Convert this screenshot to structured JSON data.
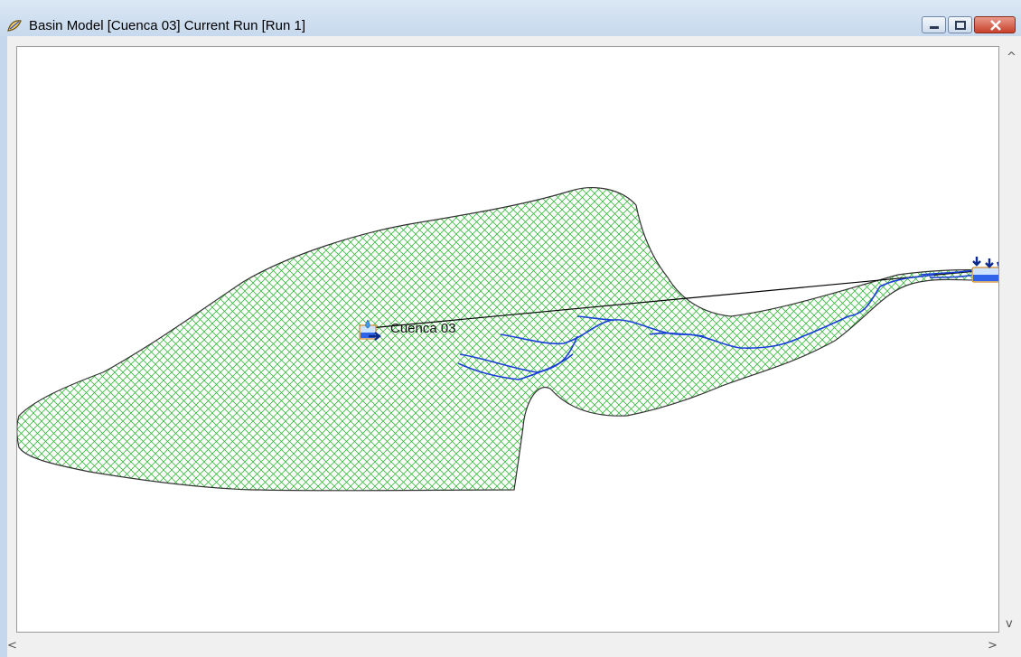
{
  "window": {
    "title": "Basin Model [Cuenca 03]  Current Run [Run 1]",
    "icon": "basin-model-icon",
    "controls": {
      "minimize": "minimize-icon",
      "maximize": "maximize-icon",
      "close": "close-icon"
    }
  },
  "map": {
    "subbasin": {
      "name": "Cuenca 03",
      "icon": "subbasin-icon",
      "fill_color": "#2fb52f",
      "outline_color": "#333333"
    },
    "outlet": {
      "icon": "sink-icon"
    },
    "streams": {
      "color": "#1a3fd8"
    },
    "connector": {
      "color": "#000000"
    }
  },
  "scrollbars": {
    "up": "scroll-up-icon",
    "down": "scroll-down-icon",
    "left": "scroll-left-icon",
    "right": "scroll-right-icon"
  }
}
